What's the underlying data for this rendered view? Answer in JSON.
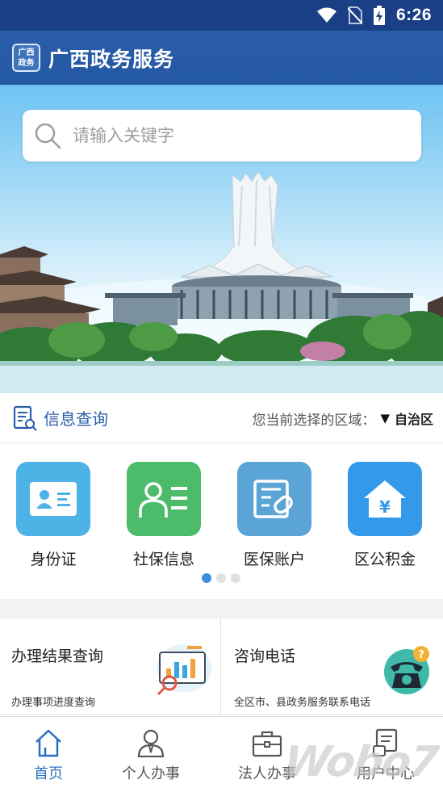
{
  "status_bar": {
    "time": "6:26",
    "icons": [
      "wifi-icon",
      "no-sim-icon",
      "battery-charging-icon"
    ]
  },
  "app_bar": {
    "logo_line1": "广西",
    "logo_line2": "政务",
    "title": "广西政务服务"
  },
  "search": {
    "placeholder": "请输入关键字",
    "icon": "search-icon"
  },
  "info_bar": {
    "title": "信息查询",
    "region_label": "您当前选择的区域：",
    "region_arrow": "▼",
    "region_value": "自治区"
  },
  "quick_services": [
    {
      "label": "身份证",
      "icon": "id-card-icon",
      "color": "#4db3e6"
    },
    {
      "label": "社保信息",
      "icon": "social-security-icon",
      "color": "#4cbc6b"
    },
    {
      "label": "医保账户",
      "icon": "medical-insurance-icon",
      "color": "#5aa5d6"
    },
    {
      "label": "区公积金",
      "icon": "housing-fund-icon",
      "color": "#3399e8"
    }
  ],
  "pager": {
    "pages": 3,
    "active_index": 0
  },
  "cards": [
    {
      "title": "办理结果查询",
      "subtitle": "办理事项进度查询",
      "icon": "report-search-icon"
    },
    {
      "title": "咨询电话",
      "subtitle": "全区市、县政务服务联系电话",
      "icon": "telephone-icon"
    }
  ],
  "tab_bar": [
    {
      "label": "首页",
      "icon": "home-icon",
      "active": true
    },
    {
      "label": "个人办事",
      "icon": "person-icon",
      "active": false
    },
    {
      "label": "法人办事",
      "icon": "briefcase-icon",
      "active": false
    },
    {
      "label": "用户中心",
      "icon": "user-center-icon",
      "active": false
    }
  ],
  "watermark": "Wobo7",
  "colors": {
    "status_bar": "#1a3f85",
    "app_bar": "#2b5ea9",
    "accent": "#2b6fc2"
  }
}
